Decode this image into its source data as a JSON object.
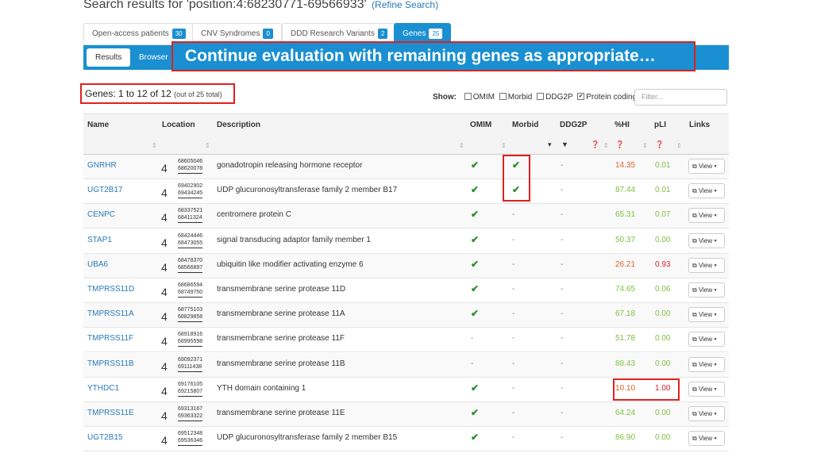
{
  "header": {
    "title": "Search results for 'position:4:68230771-69566933'",
    "refine": "(Refine Search)"
  },
  "tabs": [
    {
      "label": "Open-access patients",
      "count": "30"
    },
    {
      "label": "CNV Syndromes",
      "count": "0"
    },
    {
      "label": "DDD Research Variants",
      "count": "2"
    },
    {
      "label": "Genes",
      "count": "25"
    }
  ],
  "subtabs": {
    "results": "Results",
    "browser": "Browser"
  },
  "callout": "Continue evaluation with remaining genes as appropriate…",
  "summary": {
    "main": "Genes: 1 to 12 of 12",
    "total": "(out of 25 total)"
  },
  "show": {
    "label": "Show:",
    "omim": "OMIM",
    "morbid": "Morbid",
    "ddg2p": "DDG2P",
    "protein": "Protein coding",
    "protein_checked": true
  },
  "filter_placeholder": "Filter...",
  "columns": {
    "name": "Name",
    "location": "Location",
    "description": "Description",
    "omim": "OMIM",
    "morbid": "Morbid",
    "ddg2p": "DDG2P",
    "hi": "%HI",
    "pli": "pLI",
    "links": "Links"
  },
  "view_label": "View",
  "icons": {
    "check": "check-icon",
    "sort": "sort-icon",
    "filter": "filter-icon",
    "help": "help-icon",
    "external": "external-link-icon"
  },
  "colors": {
    "accent": "#1a8fd1",
    "highlight": "#e0201e",
    "hi_low": "#e0602a",
    "hi_high": "#7fbf3f",
    "pli_high": "#d0202a"
  },
  "rows": [
    {
      "gene": "GNRHR",
      "chrom": "4",
      "start": "68605046",
      "end": "68620078",
      "desc": "gonadotropin releasing hormone receptor",
      "omim": true,
      "morbid": true,
      "ddg2p": "-",
      "hi": "14.35",
      "pli": "0.01"
    },
    {
      "gene": "UGT2B17",
      "chrom": "4",
      "start": "69402902",
      "end": "69434245",
      "desc": "UDP glucuronosyltransferase family 2 member B17",
      "omim": true,
      "morbid": true,
      "ddg2p": "-",
      "hi": "87.44",
      "pli": "0.01"
    },
    {
      "gene": "CENPC",
      "chrom": "4",
      "start": "68337521",
      "end": "68411324",
      "desc": "centromere protein C",
      "omim": true,
      "morbid": false,
      "ddg2p": "-",
      "hi": "65.31",
      "pli": "0.07"
    },
    {
      "gene": "STAP1",
      "chrom": "4",
      "start": "68424446",
      "end": "68473055",
      "desc": "signal transducing adaptor family member 1",
      "omim": true,
      "morbid": false,
      "ddg2p": "-",
      "hi": "50.37",
      "pli": "0.00"
    },
    {
      "gene": "UBA6",
      "chrom": "4",
      "start": "68478370",
      "end": "68566897",
      "desc": "ubiquitin like modifier activating enzyme 6",
      "omim": true,
      "morbid": false,
      "ddg2p": "-",
      "hi": "26.21",
      "pli": "0.93"
    },
    {
      "gene": "TMPRSS11D",
      "chrom": "4",
      "start": "68686594",
      "end": "68749750",
      "desc": "transmembrane serine protease 11D",
      "omim": true,
      "morbid": false,
      "ddg2p": "-",
      "hi": "74.65",
      "pli": "0.06"
    },
    {
      "gene": "TMPRSS11A",
      "chrom": "4",
      "start": "68775103",
      "end": "68829858",
      "desc": "transmembrane serine protease 11A",
      "omim": true,
      "morbid": false,
      "ddg2p": "-",
      "hi": "67.18",
      "pli": "0.00"
    },
    {
      "gene": "TMPRSS11F",
      "chrom": "4",
      "start": "68918916",
      "end": "68995598",
      "desc": "transmembrane serine protease 11F",
      "omim": false,
      "morbid": false,
      "ddg2p": "-",
      "hi": "51.78",
      "pli": "0.00"
    },
    {
      "gene": "TMPRSS11B",
      "chrom": "4",
      "start": "69092371",
      "end": "69111438",
      "desc": "transmembrane serine protease 11B",
      "omim": false,
      "morbid": false,
      "ddg2p": "-",
      "hi": "88.43",
      "pli": "0.00"
    },
    {
      "gene": "YTHDC1",
      "chrom": "4",
      "start": "69176105",
      "end": "69215807",
      "desc": "YTH domain containing 1",
      "omim": true,
      "morbid": false,
      "ddg2p": "-",
      "hi": "10.10",
      "pli": "1.00"
    },
    {
      "gene": "TMPRSS11E",
      "chrom": "4",
      "start": "69313167",
      "end": "69363322",
      "desc": "transmembrane serine protease 11E",
      "omim": true,
      "morbid": false,
      "ddg2p": "-",
      "hi": "64.24",
      "pli": "0.00"
    },
    {
      "gene": "UGT2B15",
      "chrom": "4",
      "start": "69512348",
      "end": "69536346",
      "desc": "UDP glucuronosyltransferase family 2 member B15",
      "omim": true,
      "morbid": false,
      "ddg2p": "-",
      "hi": "86.90",
      "pli": "0.00"
    }
  ]
}
